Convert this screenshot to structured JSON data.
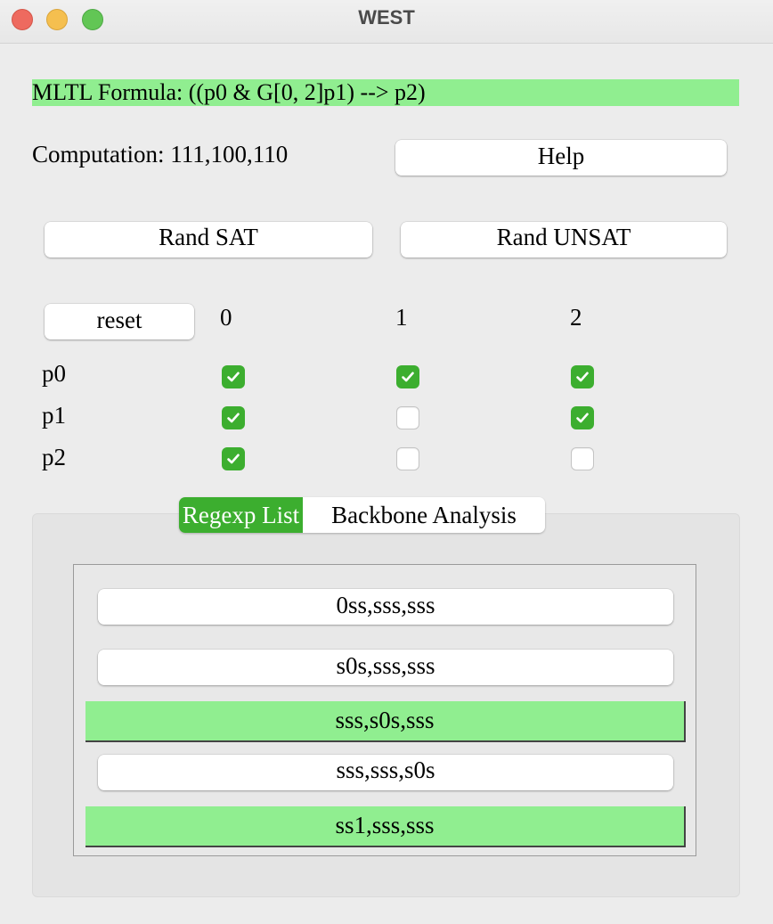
{
  "window": {
    "title": "WEST"
  },
  "formula": {
    "text": "MLTL Formula: ((p0 & G[0, 2]p1) --> p2)"
  },
  "computation": {
    "text": "Computation: 111,100,110"
  },
  "buttons": {
    "help": "Help",
    "rand_sat": "Rand SAT",
    "rand_unsat": "Rand UNSAT",
    "reset": "reset"
  },
  "grid": {
    "columns": [
      "0",
      "1",
      "2"
    ],
    "rows": [
      {
        "label": "p0",
        "values": [
          true,
          true,
          true
        ]
      },
      {
        "label": "p1",
        "values": [
          true,
          false,
          true
        ]
      },
      {
        "label": "p2",
        "values": [
          true,
          false,
          false
        ]
      }
    ]
  },
  "tabs": [
    {
      "label": "Regexp List",
      "active": true
    },
    {
      "label": "Backbone Analysis",
      "active": false
    }
  ],
  "regexp_list": [
    {
      "text": "0ss,sss,sss",
      "highlighted": false
    },
    {
      "text": "s0s,sss,sss",
      "highlighted": false
    },
    {
      "text": "sss,s0s,sss",
      "highlighted": true
    },
    {
      "text": "sss,sss,s0s",
      "highlighted": false
    },
    {
      "text": "ss1,sss,sss",
      "highlighted": true
    }
  ],
  "colors": {
    "highlight": "#90ee90",
    "accent": "#3cae2f"
  }
}
